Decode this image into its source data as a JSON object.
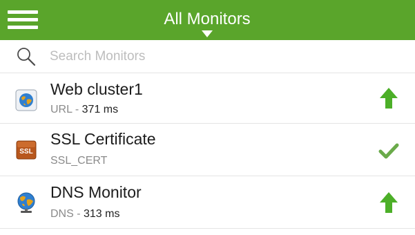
{
  "header": {
    "title": "All Monitors",
    "color": "#5aa52b",
    "menu_icon": "hamburger-menu-icon",
    "dropdown_icon": "caret-down-icon"
  },
  "search": {
    "placeholder": "Search Monitors",
    "value": "",
    "icon": "search-icon"
  },
  "monitors": [
    {
      "name": "Web cluster1",
      "type": "URL",
      "separator": " - ",
      "response_time": "371 ms",
      "icon": "globe-icon",
      "status": "up",
      "status_icon": "arrow-up-icon",
      "status_color": "#4caf28"
    },
    {
      "name": "SSL Certificate",
      "type": "SSL_CERT",
      "separator": "",
      "response_time": "",
      "icon": "ssl-certificate-icon",
      "status": "ok",
      "status_icon": "checkmark-icon",
      "status_color": "#6aaa4a"
    },
    {
      "name": "DNS Monitor",
      "type": "DNS",
      "separator": " - ",
      "response_time": "313 ms",
      "icon": "dns-globe-icon",
      "status": "up",
      "status_icon": "arrow-up-icon",
      "status_color": "#4caf28"
    }
  ]
}
